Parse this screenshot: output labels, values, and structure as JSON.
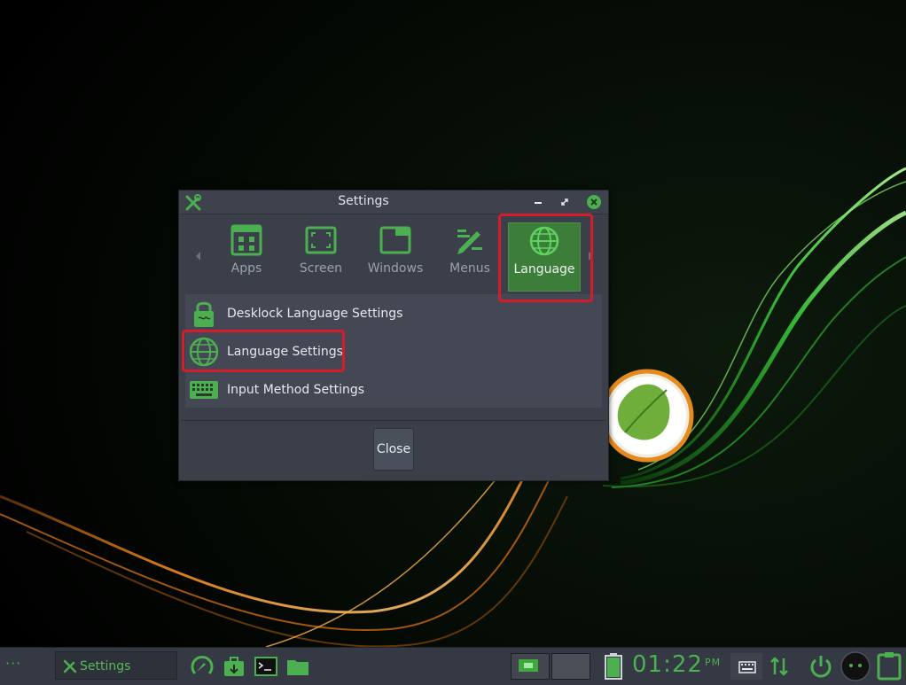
{
  "window": {
    "title": "Settings",
    "tabs": [
      {
        "label": "Apps",
        "icon": "apps-icon",
        "selected": false
      },
      {
        "label": "Screen",
        "icon": "screen-icon",
        "selected": false
      },
      {
        "label": "Windows",
        "icon": "windows-icon",
        "selected": false
      },
      {
        "label": "Menus",
        "icon": "menus-icon",
        "selected": false
      },
      {
        "label": "Language",
        "icon": "globe-icon",
        "selected": true
      }
    ],
    "items": [
      {
        "label": "Desklock Language Settings",
        "icon": "lock-icon"
      },
      {
        "label": "Language Settings",
        "icon": "globe-icon"
      },
      {
        "label": "Input Method Settings",
        "icon": "keyboard-icon"
      }
    ],
    "close_label": "Close"
  },
  "taskbar": {
    "menu_dots": "···",
    "task_label": "Settings",
    "clock": {
      "time": "01:22",
      "ampm": "PM"
    }
  },
  "colors": {
    "accent": "#4caf50",
    "selected_tab": "#3c7d3a",
    "highlight": "#d41c2c",
    "window_bg": "#3a3f4a",
    "taskbar_bg": "#343944"
  }
}
